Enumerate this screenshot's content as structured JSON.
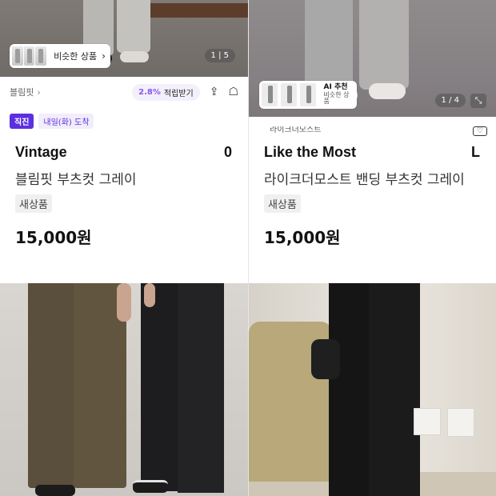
{
  "products": [
    {
      "photo_counter": "1 | 5",
      "similar_label": "비슷한 상품",
      "shop_name": "블림핏",
      "points_rate": "2.8%",
      "points_label": "적립받기",
      "tag_direct": "직진",
      "tag_delivery": "내일(화) 도착",
      "brand": "Vintage",
      "size": "0",
      "name": "블림핏 부츠컷 그레이",
      "condition": "새상품",
      "price": "15,000원"
    },
    {
      "photo_counter": "1 / 4",
      "ai_title": "AI 추천",
      "ai_sub": "비슷한 상품",
      "shop_name": "라이크더모스트",
      "brand": "Like the Most",
      "size": "L",
      "name": "라이크더모스트 밴딩 부츠컷 그레이",
      "condition": "새상품",
      "price": "15,000원"
    }
  ],
  "icons": [
    "chevron-right-icon",
    "share-icon",
    "cart-icon",
    "expand-icon",
    "heart-icon"
  ]
}
